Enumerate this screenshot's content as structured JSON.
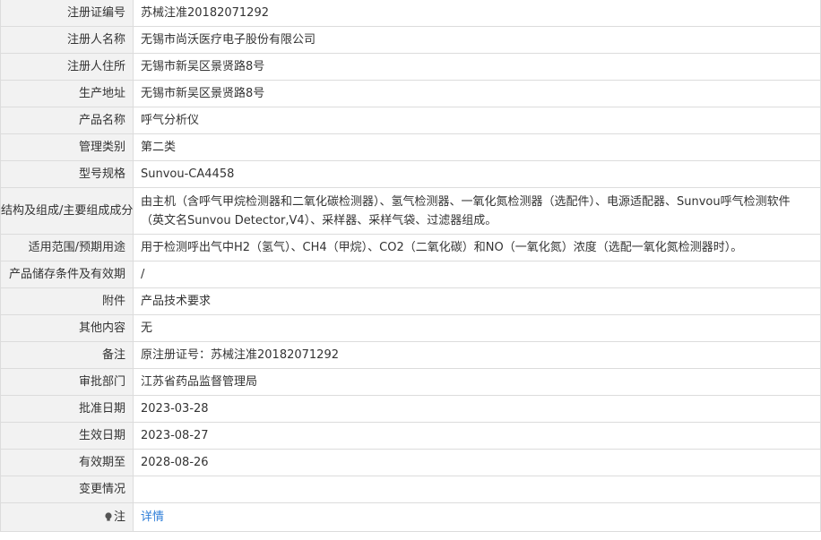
{
  "rows": [
    {
      "label": "注册证编号",
      "value": "苏械注准20182071292"
    },
    {
      "label": "注册人名称",
      "value": "无锡市尚沃医疗电子股份有限公司"
    },
    {
      "label": "注册人住所",
      "value": "无锡市新吴区景贤路8号"
    },
    {
      "label": "生产地址",
      "value": "无锡市新吴区景贤路8号"
    },
    {
      "label": "产品名称",
      "value": "呼气分析仪"
    },
    {
      "label": "管理类别",
      "value": "第二类"
    },
    {
      "label": "型号规格",
      "value": "Sunvou-CA4458"
    },
    {
      "label": "结构及组成/主要组成成分",
      "value": "由主机（含呼气甲烷检测器和二氧化碳检测器）、氢气检测器、一氧化氮检测器（选配件）、电源适配器、Sunvou呼气检测软件（英文名Sunvou Detector,V4）、采样器、采样气袋、过滤器组成。"
    },
    {
      "label": "适用范围/预期用途",
      "value": "用于检测呼出气中H2（氢气）、CH4（甲烷）、CO2（二氧化碳）和NO（一氧化氮）浓度（选配一氧化氮检测器时）。"
    },
    {
      "label": "产品储存条件及有效期",
      "value": "/"
    },
    {
      "label": "附件",
      "value": "产品技术要求"
    },
    {
      "label": "其他内容",
      "value": "无"
    },
    {
      "label": "备注",
      "value": "原注册证号：苏械注准20182071292"
    },
    {
      "label": "审批部门",
      "value": "江苏省药品监督管理局"
    },
    {
      "label": "批准日期",
      "value": "2023-03-28"
    },
    {
      "label": "生效日期",
      "value": "2023-08-27"
    },
    {
      "label": "有效期至",
      "value": "2028-08-26"
    },
    {
      "label": "变更情况",
      "value": ""
    }
  ],
  "note": {
    "icon": "lightbulb-icon",
    "label": "注",
    "link_text": "详情",
    "link_color": "#2e7ed8"
  }
}
